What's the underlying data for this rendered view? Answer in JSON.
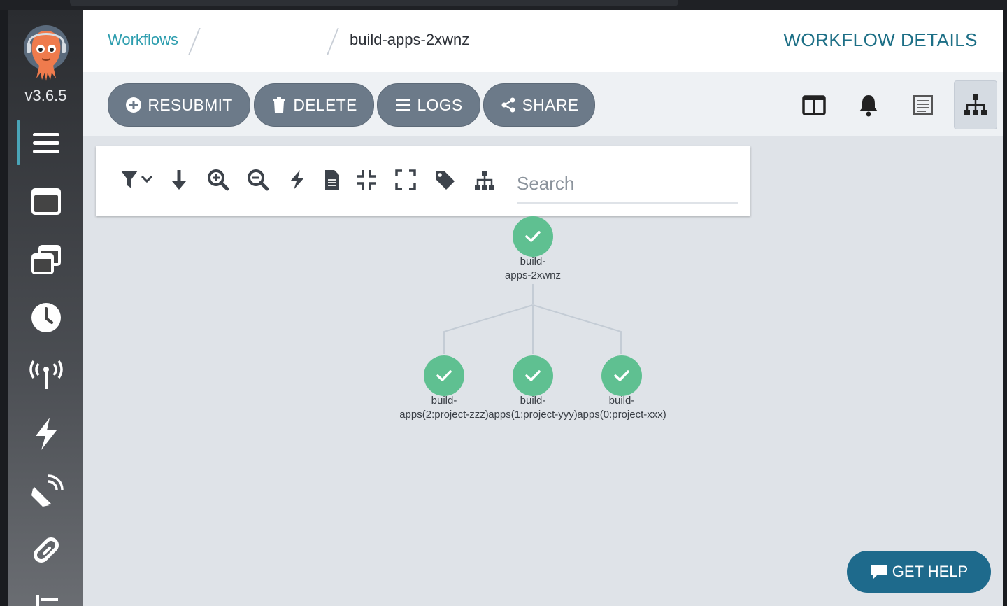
{
  "app": {
    "version": "v3.6.5"
  },
  "breadcrumb": {
    "root": "Workflows",
    "current": "build-apps-2xwnz"
  },
  "header": {
    "title": "WORKFLOW DETAILS"
  },
  "actions": {
    "resubmit": "RESUBMIT",
    "delete": "DELETE",
    "logs": "LOGS",
    "share": "SHARE"
  },
  "view_icons": [
    "split-panel-icon",
    "bell-icon",
    "settings-list-icon",
    "sitemap-icon"
  ],
  "graph_toolbar": {
    "icons": [
      "filter-icon",
      "download-arrow-icon",
      "zoom-in-icon",
      "zoom-out-icon",
      "lightning-icon",
      "file-icon",
      "compress-icon",
      "expand-icon",
      "tag-icon",
      "sitemap-icon"
    ],
    "search_placeholder": "Search"
  },
  "graph": {
    "root": {
      "label_line1": "build-",
      "label_line2": "apps-2xwnz",
      "status": "succeeded"
    },
    "children": [
      {
        "label_line1": "build-",
        "label_line2": "apps(2:project-zzz)",
        "status": "succeeded"
      },
      {
        "label_line1": "build-",
        "label_line2": "apps(1:project-yyy)",
        "status": "succeeded"
      },
      {
        "label_line1": "build-",
        "label_line2": "apps(0:project-xxx)",
        "status": "succeeded"
      }
    ]
  },
  "help": {
    "label": "GET HELP"
  },
  "colors": {
    "accent": "#2c9dae",
    "title": "#1d6f86",
    "button": "#6c7a89",
    "success": "#5fc091",
    "help": "#1e6a8c"
  }
}
